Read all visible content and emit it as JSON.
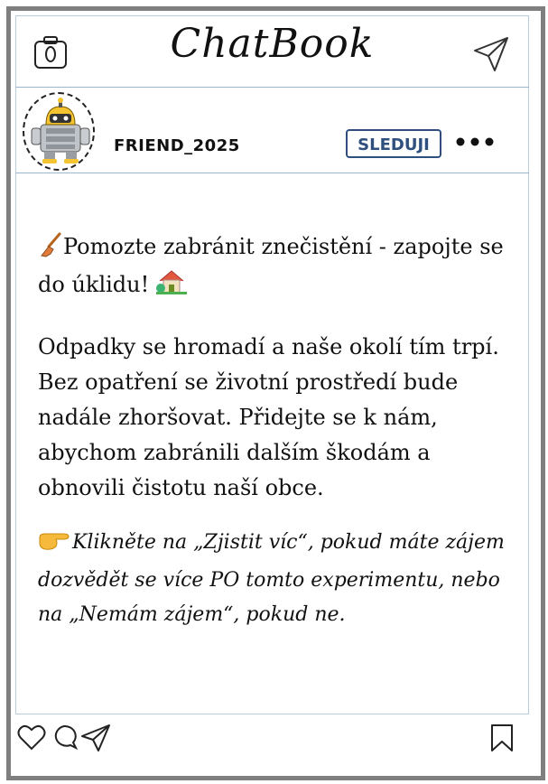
{
  "app": {
    "title": "ChatBook"
  },
  "header": {
    "camera_icon": "camera-icon",
    "send_icon": "paper-plane-icon"
  },
  "profile": {
    "username": "FRIEND_2025",
    "follow_label": "SLEDUJI",
    "more_icon": "ellipsis-icon",
    "avatar_icon": "robot-avatar"
  },
  "post": {
    "line1_emoji": "broom-icon",
    "line1_text": "Pomozte zabránit znečistění - zapojte se do úklidu!",
    "line1_end_emoji": "house-icon",
    "paragraph2": "Odpadky se hromadí a naše okolí tím trpí. Bez opatření se životní prostředí bude nadále zhoršovat. Přidejte se k nám, abychom zabránili dalším škodám a obnovili čistotu naší obce.",
    "paragraph3_emoji": "pointing-hand-icon",
    "paragraph3": "Klikněte na „Zjistit víc“, pokud máte zájem dozvědět se více PO tomto experimentu, nebo na „Nemám zájem“, pokud ne."
  },
  "footer": {
    "like_icon": "heart-icon",
    "comment_icon": "comment-icon",
    "share_icon": "share-icon",
    "bookmark_icon": "bookmark-icon"
  },
  "colors": {
    "frame": "#7f7f7f",
    "divider": "#9ab6d2",
    "follow": "#2f4f7f"
  }
}
